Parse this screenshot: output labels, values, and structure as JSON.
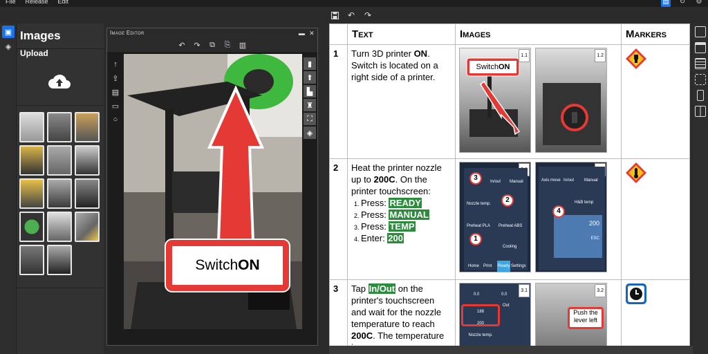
{
  "menu": {
    "file": "File",
    "release": "Release",
    "edit": "Edit"
  },
  "panel": {
    "title": "Images",
    "upload_label": "Upload"
  },
  "editor": {
    "title": "Image Editor",
    "callout": "Switch ",
    "callout_bold": "ON"
  },
  "doc": {
    "headers": {
      "text": "Text",
      "images": "Images",
      "markers": "Markers"
    },
    "rows": [
      {
        "num": "1",
        "text_pre": "Turn 3D printer ",
        "text_bold": "ON",
        "text_post": ". Switch is located on a right side of a printer.",
        "img_a": "1.1",
        "img_b": "1.2",
        "callout": "Switch ",
        "callout_bold": "ON"
      },
      {
        "num": "2",
        "text_pre": "Heat the printer nozzle up to ",
        "text_bold": "200C",
        "text_post": ". On the printer touchscreen:",
        "img_a": "2.1",
        "img_b": "2.2",
        "steps": [
          {
            "label": "Press: ",
            "hl": "READY"
          },
          {
            "label": "Press: ",
            "hl": "MANUAL"
          },
          {
            "label": "Press: ",
            "hl": "TEMP"
          },
          {
            "label": "Enter: ",
            "hl": "200"
          }
        ],
        "screen": {
          "inout": "In/out",
          "manual": "Manual",
          "nozzle": "Nozzle temp.",
          "preheat_pla": "Preheat PLA",
          "preheat_abs": "Preheat ABS",
          "cooling": "Cooling",
          "home": "Home",
          "print": "Print",
          "ready": "Ready",
          "settings": "Settings",
          "axis_move": "Axis move",
          "hb_temp": "H&B temp",
          "value": "200",
          "esc": "ESC"
        }
      },
      {
        "num": "3",
        "text_pre": "Tap ",
        "text_hl": "In/Out",
        "text_post": " on the printer's touchscreen and wait for the nozzle temperature to reach ",
        "text_bold": "200C",
        "text_post2": ". The temperature is",
        "img_a": "3.1",
        "img_b": "3.2",
        "screen_val": "0.0",
        "out": "Out",
        "temp_big": "188",
        "temp_small": "200",
        "nozzle": "Nozzle temp.",
        "push": "Push the lever left"
      }
    ]
  },
  "colors": {
    "accent": "#1a73e8",
    "highlight": "#2e8b3d",
    "callout_red": "#e53935"
  }
}
